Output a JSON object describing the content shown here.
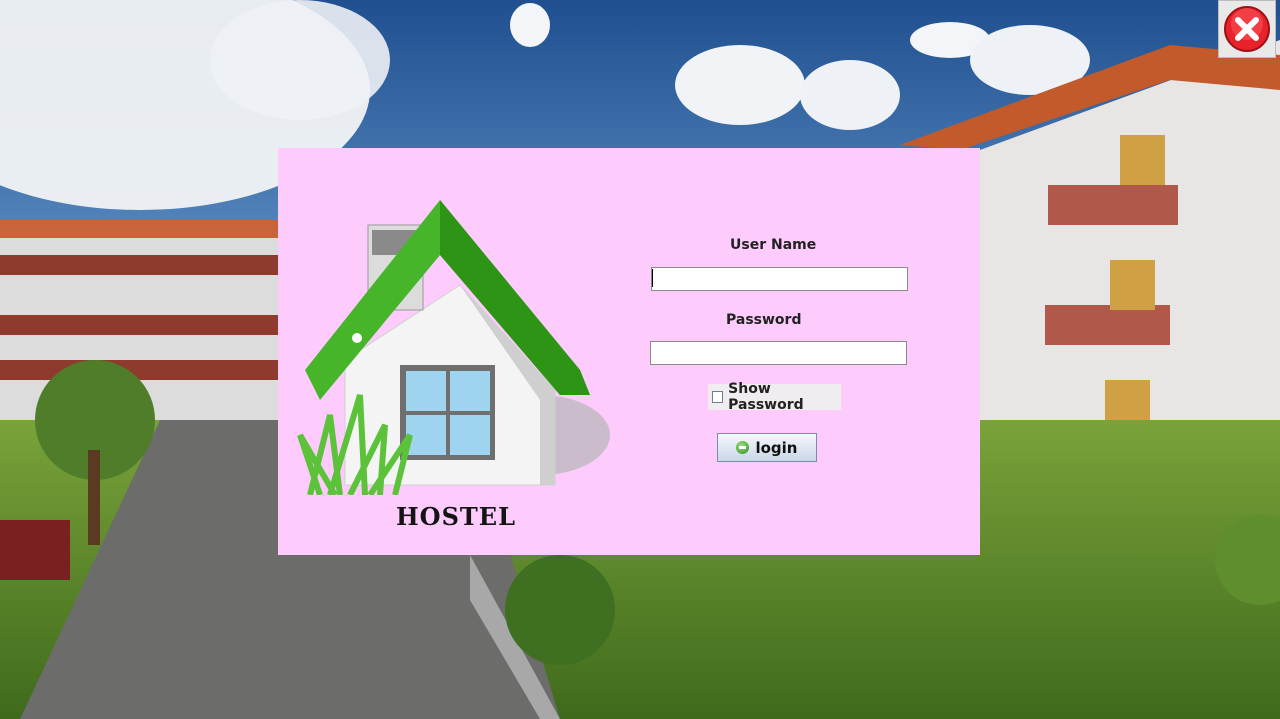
{
  "window": {
    "close_icon": "close-icon",
    "close_color": "#e8222b"
  },
  "panel": {
    "background": "#fdccfd"
  },
  "brand": {
    "logo_icon": "house-icon",
    "text": "HOSTEL"
  },
  "form": {
    "username_label": "User Name",
    "username_value": "",
    "password_label": "Password",
    "password_value": "",
    "show_password_label": "Show Password",
    "show_password_checked": false,
    "login_label": "login",
    "login_icon": "minus-circle-icon"
  }
}
